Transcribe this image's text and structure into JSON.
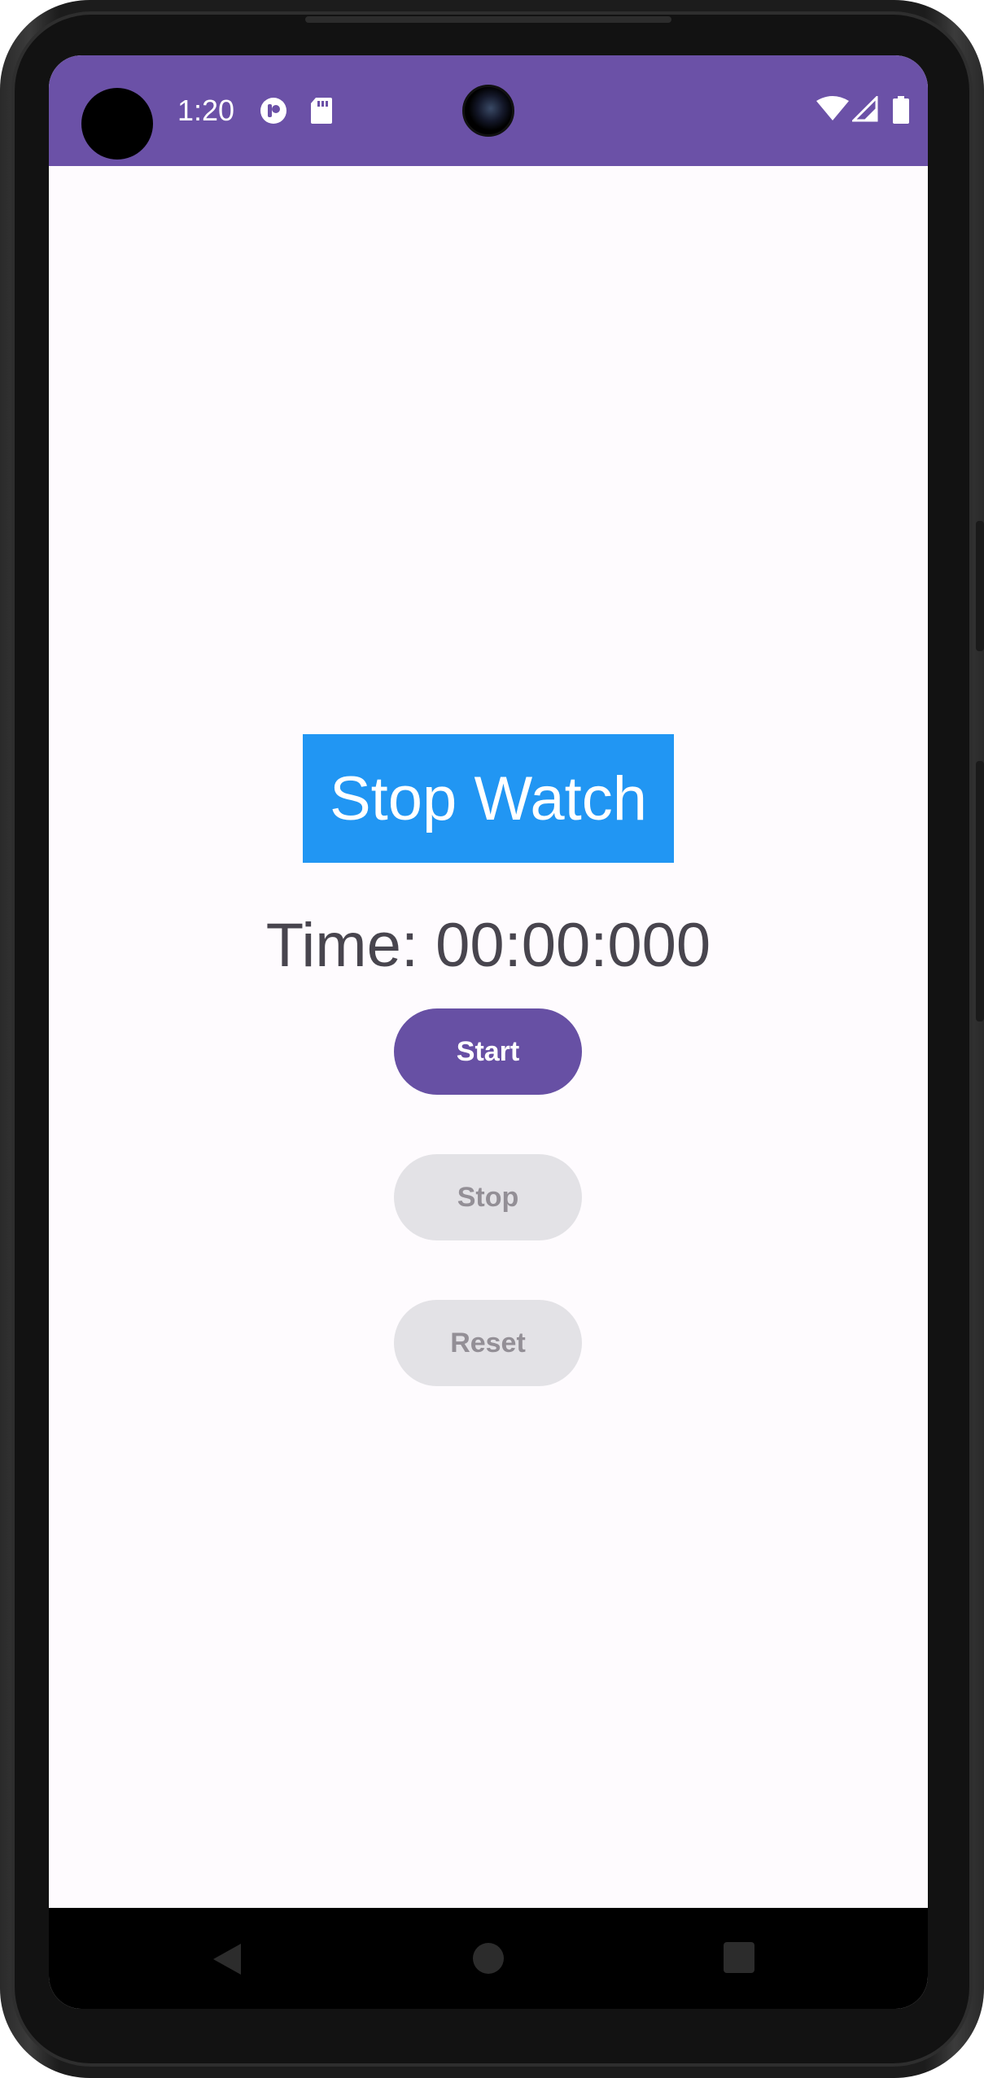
{
  "status_bar": {
    "time": "1:20",
    "icons": [
      "privacy-indicator-icon",
      "sd-card-icon",
      "wifi-icon",
      "cell-signal-icon",
      "battery-icon"
    ],
    "background": "#6b51a7"
  },
  "app": {
    "title": "Stop Watch",
    "title_background": "#2196f3",
    "time_display": "Time: 00:00:000",
    "buttons": {
      "start": {
        "label": "Start",
        "enabled": true,
        "color": "#6750a4"
      },
      "stop": {
        "label": "Stop",
        "enabled": false,
        "color": "#e3e2e6"
      },
      "reset": {
        "label": "Reset",
        "enabled": false,
        "color": "#e3e2e6"
      }
    }
  },
  "nav_bar": {
    "icons": [
      "back-icon",
      "home-icon",
      "recents-icon"
    ]
  }
}
